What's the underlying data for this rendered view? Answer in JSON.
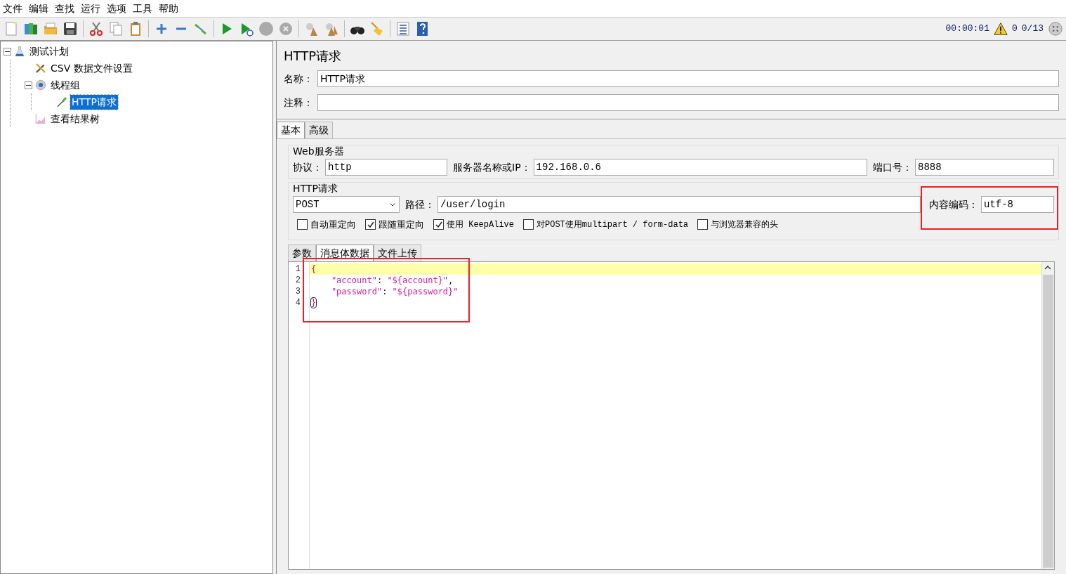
{
  "menu": [
    "文件",
    "编辑",
    "查找",
    "运行",
    "选项",
    "工具",
    "帮助"
  ],
  "status": {
    "elapsed": "00:00:01",
    "warnings": "0",
    "threads": "0/13"
  },
  "tree": [
    {
      "label": "测试计划",
      "kind": "plan",
      "expanded": true,
      "selected": false,
      "children": [
        {
          "label": "CSV 数据文件设置",
          "kind": "config",
          "selected": false
        },
        {
          "label": "线程组",
          "kind": "threads",
          "expanded": true,
          "selected": false,
          "children": [
            {
              "label": "HTTP请求",
              "kind": "sampler",
              "selected": true
            }
          ]
        },
        {
          "label": "查看结果树",
          "kind": "listener",
          "selected": false
        }
      ]
    }
  ],
  "panel": {
    "title": "HTTP请求",
    "name_label": "名称：",
    "name_value": "HTTP请求",
    "comment_label": "注释："
  },
  "tabs": [
    {
      "label": "基本",
      "selected": true
    },
    {
      "label": "高级",
      "selected": false
    }
  ],
  "web_server": {
    "legend": "Web服务器",
    "protocol_label": "协议：",
    "protocol": "http",
    "server_label": "服务器名称或IP：",
    "server": "192.168.0.6",
    "port_label": "端口号：",
    "port": "8888"
  },
  "http_request": {
    "legend": "HTTP请求",
    "method": "POST",
    "path_label": "路径：",
    "path": "/user/login",
    "encoding_label": "内容编码：",
    "encoding": "utf-8",
    "options": [
      {
        "label": "自动重定向",
        "checked": false
      },
      {
        "label": "跟随重定向",
        "checked": true
      },
      {
        "label": "使用 KeepAlive",
        "checked": true
      },
      {
        "label": "对POST使用multipart / form-data",
        "checked": false
      },
      {
        "label": "与浏览器兼容的头",
        "checked": false
      }
    ]
  },
  "body_tabs": [
    {
      "label": "参数",
      "selected": false
    },
    {
      "label": "消息体数据",
      "selected": true
    },
    {
      "label": "文件上传",
      "selected": false
    }
  ],
  "body_lines": [
    {
      "number": "1",
      "current": true,
      "tokens": [
        {
          "kind": "brace",
          "text": "{"
        }
      ]
    },
    {
      "number": "2",
      "current": false,
      "tokens": [
        {
          "kind": "string",
          "text": "    \"account\""
        },
        {
          "kind": "punct",
          "text": ": "
        },
        {
          "kind": "string",
          "text": "\"${account}\""
        },
        {
          "kind": "punct",
          "text": ","
        }
      ]
    },
    {
      "number": "3",
      "current": false,
      "tokens": [
        {
          "kind": "string",
          "text": "    \"password\""
        },
        {
          "kind": "punct",
          "text": ": "
        },
        {
          "kind": "string",
          "text": "\"${password}\""
        }
      ]
    },
    {
      "number": "4",
      "current": false,
      "tokens": [
        {
          "kind": "matched-brace",
          "text": "}"
        }
      ]
    }
  ]
}
